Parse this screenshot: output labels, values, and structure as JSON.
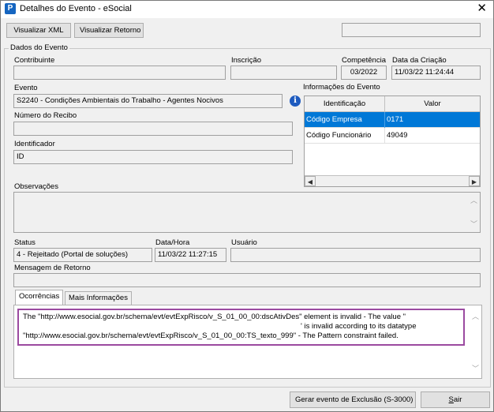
{
  "window": {
    "title": "Detalhes do Evento - eSocial",
    "app_icon": "P"
  },
  "toolbar": {
    "visualizar_xml": "Visualizar XML",
    "visualizar_retorno": "Visualizar Retorno"
  },
  "dados": {
    "group_title": "Dados do Evento",
    "contribuinte_label": "Contribuinte",
    "contribuinte_value": "",
    "inscricao_label": "Inscrição",
    "inscricao_value": "",
    "competencia_label": "Competência",
    "competencia_value": "03/2022",
    "data_criacao_label": "Data da Criação",
    "data_criacao_value": "11/03/22 11:24:44",
    "evento_label": "Evento",
    "evento_value": "S2240 - Condições Ambientais do Trabalho - Agentes Nocivos",
    "numero_recibo_label": "Número do Recibo",
    "numero_recibo_value": "",
    "identificador_label": "Identificador",
    "identificador_value": "ID",
    "observacoes_label": "Observações",
    "status_label": "Status",
    "status_value": "4 - Rejeitado (Portal de soluções)",
    "data_hora_label": "Data/Hora",
    "data_hora_value": "11/03/22 11:27:15",
    "usuario_label": "Usuário",
    "usuario_value": "",
    "mensagem_label": "Mensagem de Retorno",
    "mensagem_value": ""
  },
  "informacoes": {
    "title": "Informações do Evento",
    "columns": [
      "Identificação",
      "Valor"
    ],
    "rows": [
      {
        "id": "Código Empresa",
        "valor": "0171"
      },
      {
        "id": "Código Funcionário",
        "valor": "49049"
      }
    ]
  },
  "tabs": [
    {
      "label": "Ocorrências"
    },
    {
      "label": "Mais Informações"
    }
  ],
  "ocorrencia": {
    "line1": "The \"http://www.esocial.gov.br/schema/evt/evtExpRisco/v_S_01_00_00:dscAtivDes\" element is invalid - The value \"",
    "line2": "' is invalid according to its datatype",
    "line3": "\"http://www.esocial.gov.br/schema/evt/evtExpRisco/v_S_01_00_00:TS_texto_999\" - The Pattern constraint failed.",
    "highlight_color": "#9b4aa0"
  },
  "footer": {
    "gerar_exclusao": "Gerar evento de Exclusão (S-3000)",
    "sair": "Sair"
  },
  "colors": {
    "selection": "#0078d7",
    "info_icon": "#1e5bbf"
  }
}
